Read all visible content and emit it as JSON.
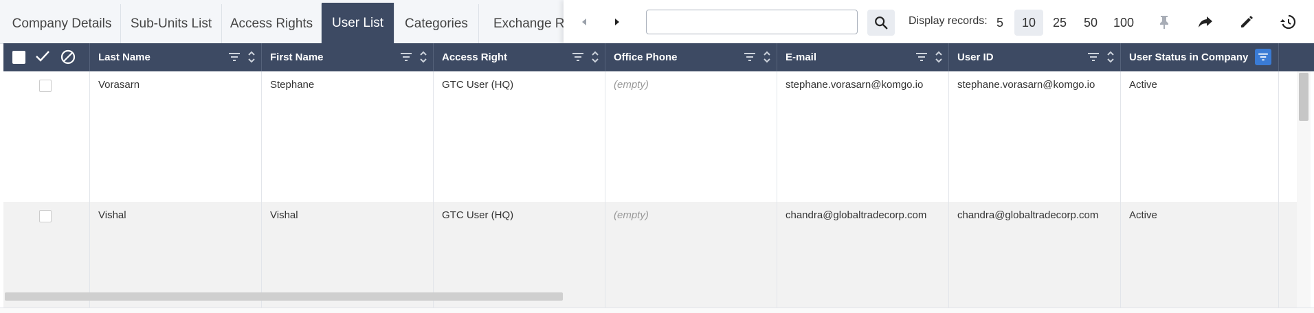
{
  "tabs": [
    {
      "label": "Company Details"
    },
    {
      "label": "Sub-Units List"
    },
    {
      "label": "Access Rights"
    },
    {
      "label": "User List",
      "active": true
    },
    {
      "label": "Categories"
    },
    {
      "label": "Exchange Rat"
    }
  ],
  "toolbar": {
    "search_value": "",
    "display_label": "Display records:",
    "record_options": [
      "5",
      "10",
      "25",
      "50",
      "100"
    ],
    "selected_records": "10",
    "icons": [
      "prev-arrow-icon",
      "next-arrow-icon",
      "search-icon",
      "pin-icon",
      "share-icon",
      "edit-icon",
      "history-icon"
    ]
  },
  "columns": [
    {
      "label": "Last Name"
    },
    {
      "label": "First Name"
    },
    {
      "label": "Access Right"
    },
    {
      "label": "Office Phone"
    },
    {
      "label": "E-mail"
    },
    {
      "label": "User ID"
    },
    {
      "label": "User Status in Company",
      "filter_active": true
    }
  ],
  "rows": [
    {
      "last_name": "Vorasarn",
      "first_name": "Stephane",
      "access_right": "GTC User (HQ)",
      "office_phone": "(empty)",
      "email": "stephane.vorasarn@komgo.io",
      "user_id": "stephane.vorasarn@komgo.io",
      "status": "Active"
    },
    {
      "last_name": "Vishal",
      "first_name": "Vishal",
      "access_right": "GTC User (HQ)",
      "office_phone": "(empty)",
      "email": "chandra@globaltradecorp.com",
      "user_id": "chandra@globaltradecorp.com",
      "status": "Active"
    }
  ],
  "colors": {
    "header_bg": "#3d4a63",
    "active_filter": "#3a7bd5",
    "alt_row": "#f2f2f2"
  }
}
